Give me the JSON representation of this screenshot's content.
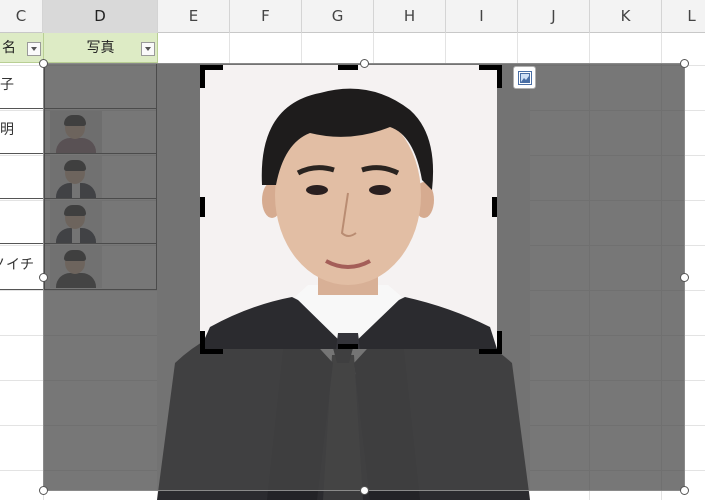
{
  "columns": [
    "C",
    "D",
    "E",
    "F",
    "G",
    "H",
    "I",
    "J",
    "K",
    "L"
  ],
  "selected_column": "D",
  "table": {
    "headers": [
      "名",
      "写真"
    ],
    "name_cells": [
      "子",
      "明",
      "",
      "",
      "ノイチ"
    ]
  },
  "icons": {
    "filter": "filter-dropdown-icon",
    "layout": "layout-options-icon"
  },
  "colors": {
    "header_bg": "#ddebc5",
    "overlay": "#484848",
    "crop_handle": "#000000"
  }
}
